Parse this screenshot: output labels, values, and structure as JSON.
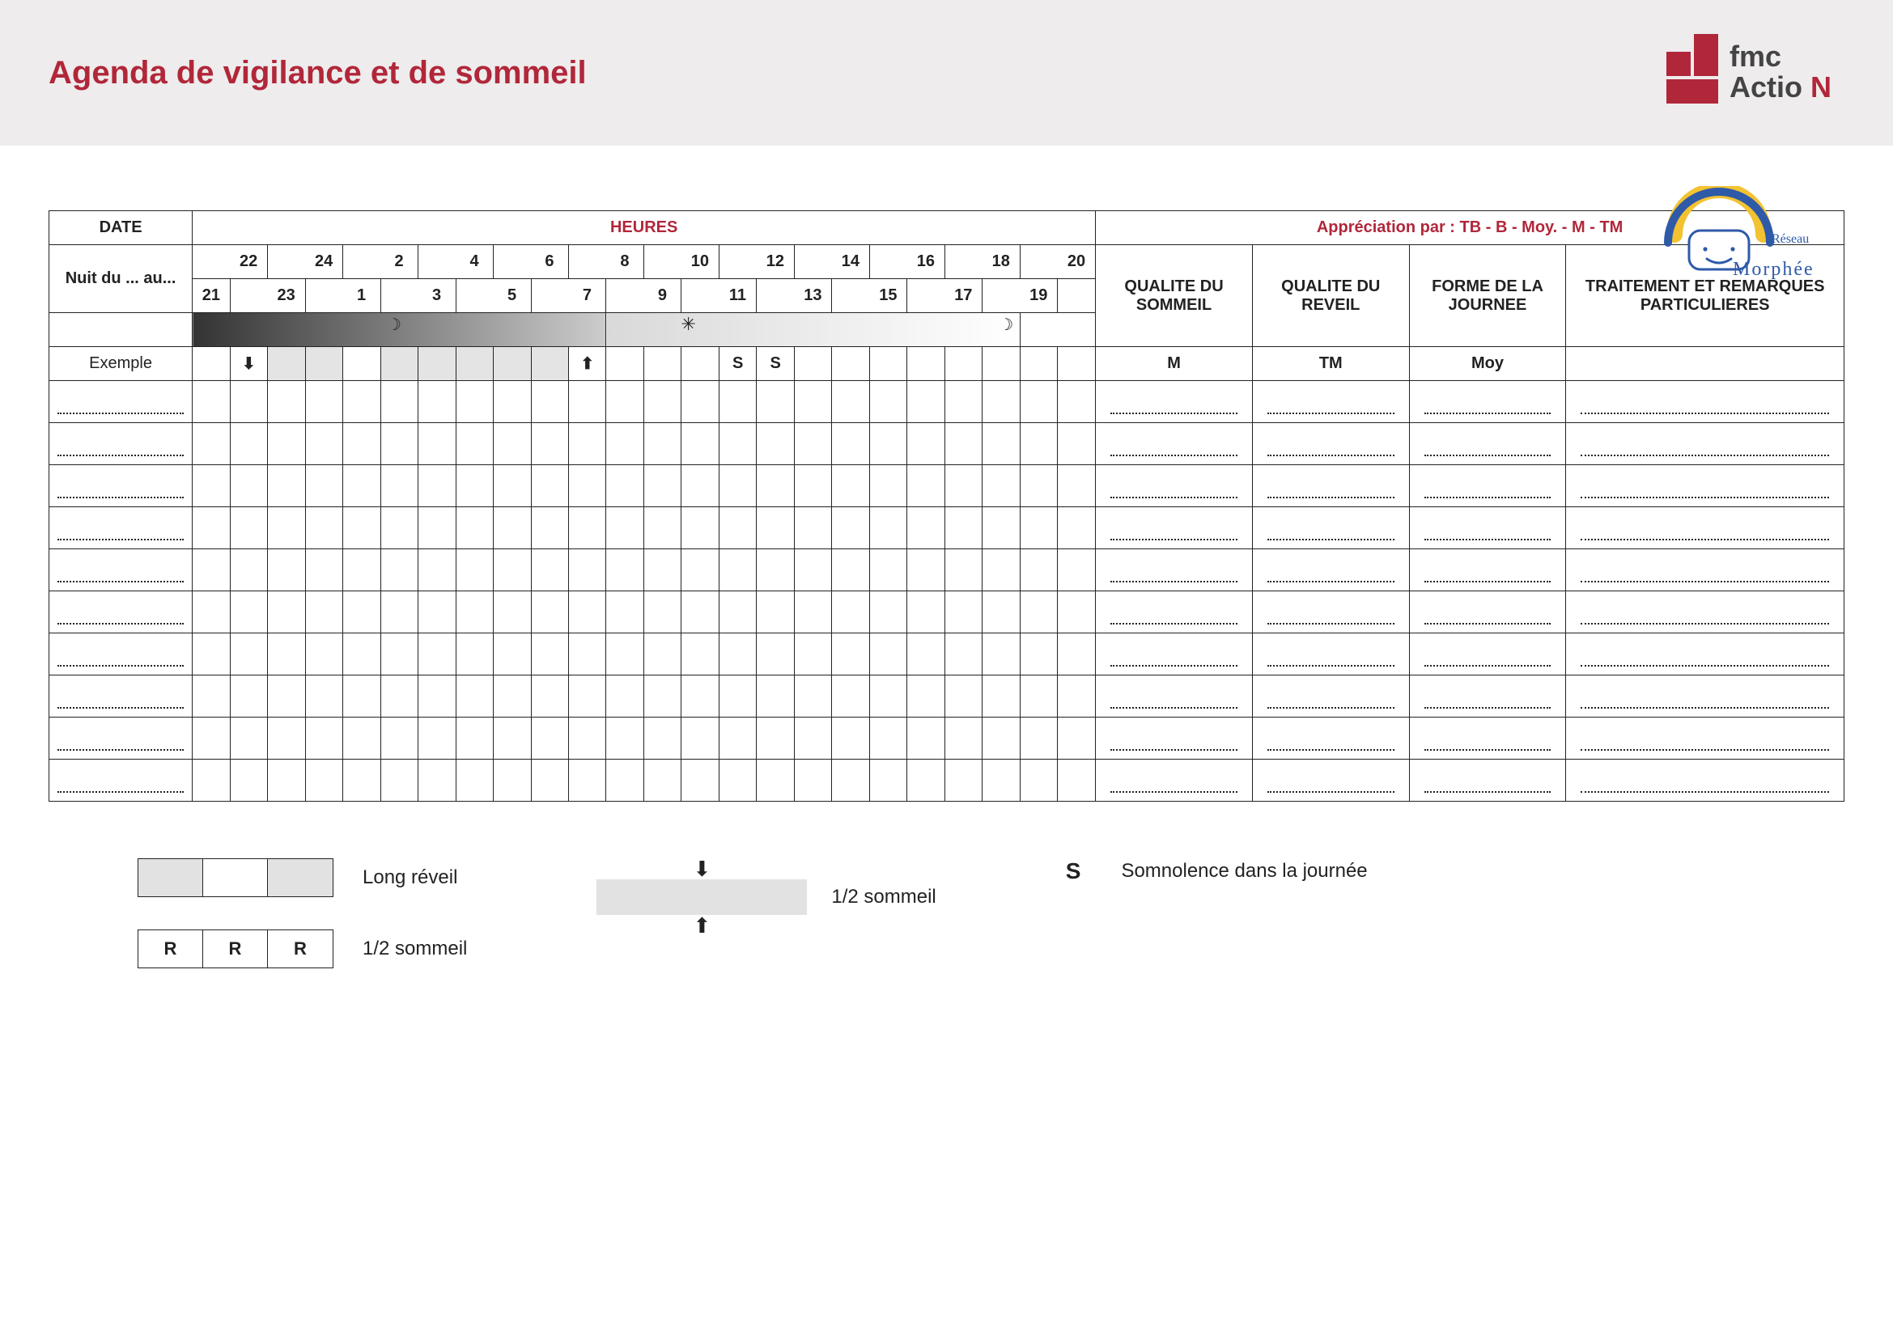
{
  "header": {
    "title": "Agenda de vigilance et de sommeil",
    "brand": "fmc ActioN"
  },
  "table": {
    "date_label": "DATE",
    "heures_label": "HEURES",
    "apprec_label": "Appréciation par : TB - B - Moy. - M - TM",
    "nuit_label": "Nuit du ... au...",
    "col_qualite_sommeil": "QUALITE DU SOMMEIL",
    "col_qualite_reveil": "QUALITE DU REVEIL",
    "col_forme_journee": "FORME DE LA JOURNEE",
    "col_traitement": "TRAITEMENT ET REMARQUES PARTICULIERES",
    "hours_top": [
      "22",
      "24",
      "2",
      "4",
      "6",
      "8",
      "10",
      "12",
      "14",
      "16",
      "18",
      "20"
    ],
    "hours_bottom": [
      "21",
      "23",
      "1",
      "3",
      "5",
      "7",
      "9",
      "11",
      "13",
      "15",
      "17",
      "19"
    ],
    "moon": "☽",
    "sun": "✳",
    "exemple_label": "Exemple",
    "exemple": {
      "sleep_down": "⬇",
      "wake_up": "⬆",
      "S": "S",
      "qualite_sommeil": "M",
      "qualite_reveil": "TM",
      "forme_journee": "Moy",
      "traitement": ""
    },
    "data_rows": 10
  },
  "legend": {
    "long_reveil": "Long réveil",
    "R": "R",
    "half_sommeil": "1/2 sommeil",
    "down": "⬇",
    "up": "⬆",
    "S": "S",
    "somnolence": "Somnolence dans la journée"
  },
  "morphee": {
    "line1": "Réseau",
    "line2": "M o r p h é e"
  }
}
